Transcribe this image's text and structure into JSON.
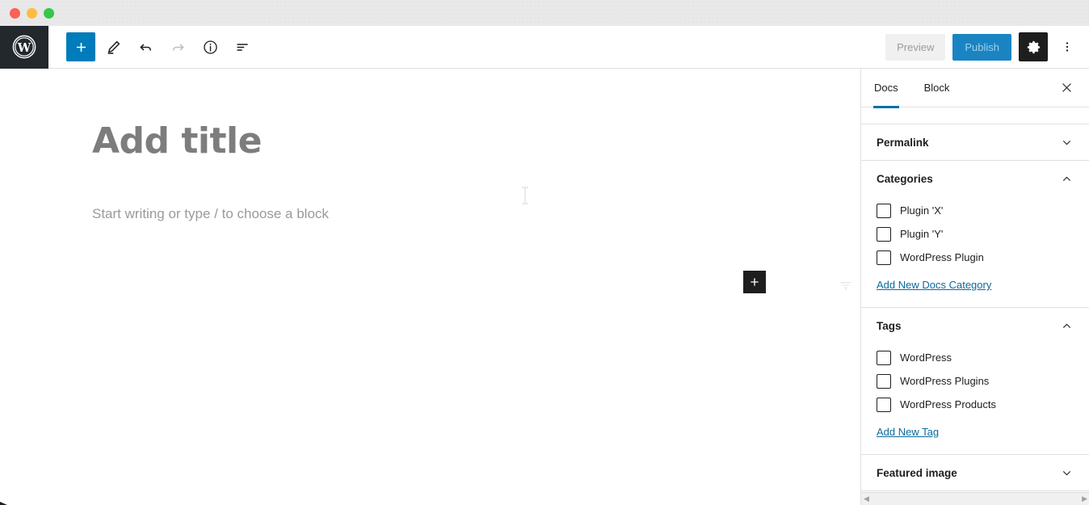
{
  "window": {
    "traffic_lights": [
      {
        "name": "close",
        "color": "#fc6058"
      },
      {
        "name": "minimize",
        "color": "#fdbc40"
      },
      {
        "name": "zoom",
        "color": "#34c749"
      }
    ]
  },
  "header": {
    "logo": "wordpress-logo",
    "left_tools": [
      {
        "name": "block-inserter",
        "label": "+",
        "icon": "plus-icon",
        "state": "primary"
      },
      {
        "name": "tools-edit",
        "label": "",
        "icon": "pencil-icon",
        "state": "default"
      },
      {
        "name": "undo",
        "label": "",
        "icon": "undo-icon",
        "state": "default"
      },
      {
        "name": "redo",
        "label": "",
        "icon": "redo-icon",
        "state": "disabled"
      },
      {
        "name": "details",
        "label": "",
        "icon": "info-icon",
        "state": "default"
      },
      {
        "name": "list-view",
        "label": "",
        "icon": "list-view-icon",
        "state": "default"
      }
    ],
    "preview_label": "Preview",
    "publish_label": "Publish",
    "settings_icon": "gear-icon",
    "more_icon": "kebab-menu-icon"
  },
  "canvas": {
    "title_placeholder": "Add title",
    "block_placeholder": "Start writing or type / to choose a block",
    "inserter_label": "+"
  },
  "sidebar": {
    "tabs": [
      {
        "label": "Docs",
        "active": true
      },
      {
        "label": "Block",
        "active": false
      }
    ],
    "close_icon": "close-icon",
    "panels": [
      {
        "title": "Permalink",
        "open": false,
        "chevron": "chevron-down-icon"
      },
      {
        "title": "Categories",
        "open": true,
        "chevron": "chevron-up-icon",
        "terms": [
          {
            "label": "Plugin 'X'",
            "checked": false
          },
          {
            "label": "Plugin 'Y'",
            "checked": false
          },
          {
            "label": "WordPress Plugin",
            "checked": false
          }
        ],
        "add_new_label": "Add New Docs Category"
      },
      {
        "title": "Tags",
        "open": true,
        "chevron": "chevron-up-icon",
        "terms": [
          {
            "label": "WordPress",
            "checked": false
          },
          {
            "label": "WordPress Plugins",
            "checked": false
          },
          {
            "label": "WordPress Products",
            "checked": false
          }
        ],
        "add_new_label": "Add New Tag"
      },
      {
        "title": "Featured image",
        "open": false,
        "chevron": "chevron-down-icon"
      }
    ],
    "scrollbar": {
      "left_arrow": "◀",
      "right_arrow": "▶"
    }
  },
  "colors": {
    "accent_blue": "#007cba",
    "tab_underline": "#0071a1",
    "link": "#0b6a9c",
    "dark": "#1e1e1e",
    "wp_bar": "#23282d"
  }
}
